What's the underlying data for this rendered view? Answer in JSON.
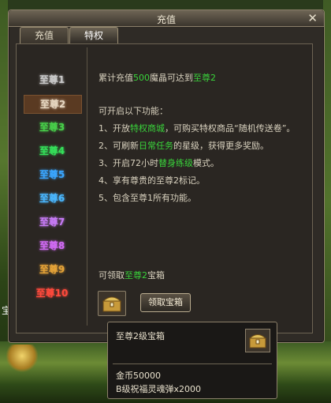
{
  "background": {
    "edge_text": "宝"
  },
  "window": {
    "title": "充值"
  },
  "tabs": [
    {
      "label": "充值",
      "active": false
    },
    {
      "label": "特权",
      "active": true
    }
  ],
  "levels": [
    {
      "label": "至尊1",
      "color": "#c9c9c9"
    },
    {
      "label": "至尊2",
      "color": "#e6d6c0",
      "selected": true
    },
    {
      "label": "至尊3",
      "color": "#48d04a"
    },
    {
      "label": "至尊4",
      "color": "#35e05a"
    },
    {
      "label": "至尊5",
      "color": "#3aa6ff"
    },
    {
      "label": "至尊6",
      "color": "#4ab7ff"
    },
    {
      "label": "至尊7",
      "color": "#c77bf6"
    },
    {
      "label": "至尊8",
      "color": "#d16bf4"
    },
    {
      "label": "至尊9",
      "color": "#e7a438"
    },
    {
      "label": "至尊10",
      "color": "#ff4a3c"
    }
  ],
  "content": {
    "req_pre": "累计充值",
    "req_amount": "500",
    "req_mid": "魔晶可达到",
    "req_level": "至尊2",
    "features_title": "可开启以下功能：",
    "f1_pre": "1、开放",
    "f1_hl": "特权商城",
    "f1_post": "，可购买特权商品“随机传送卷”。",
    "f2_pre": "2、可刷新",
    "f2_hl": "日常任务",
    "f2_post": "的星级，获得更多奖励。",
    "f3_pre": "3、开启72小时",
    "f3_hl": "替身练级",
    "f3_post": "模式。",
    "f4": "4、享有尊贵的至尊2标记。",
    "f5": "5、包含至尊1所有功能。",
    "claim_pre": "可领取",
    "claim_hl": "至尊2",
    "claim_post": "宝箱",
    "claim_button": "领取宝箱"
  },
  "tooltip": {
    "title": "至尊2级宝箱",
    "line1": "金币50000",
    "line2": "B级祝福灵魂弹x2000"
  },
  "colors": {
    "highlight_green": "#39d43b",
    "selected_bg": "#5a3a22"
  }
}
